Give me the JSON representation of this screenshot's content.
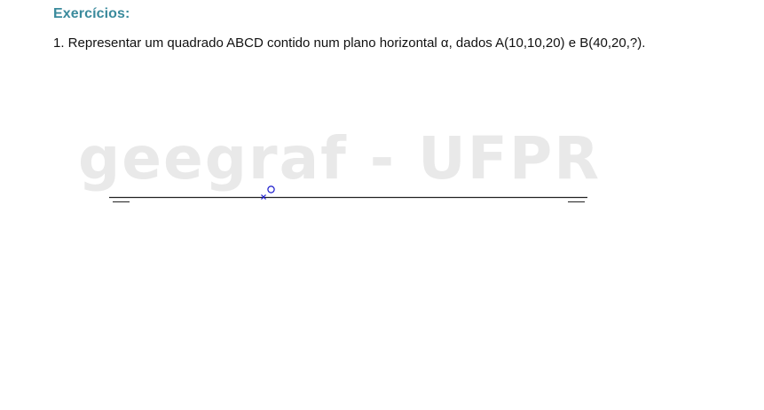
{
  "heading": "Exercícios:",
  "exercise": {
    "text": "1. Representar um quadrado ABCD contido num plano horizontal α, dados A(10,10,20) e B(40,20,?)."
  },
  "watermark": "geegraf - UFPR",
  "colors": {
    "heading": "#3a8a9c",
    "text": "#111111",
    "watermark": "#e9e9e9",
    "ground_line": "#222222",
    "point_marker": "#1a1acc"
  },
  "figure": {
    "ground_line": "x-axis line (linha de terra) with end tick marks",
    "origin_markers": [
      "x-mark",
      "circle-mark"
    ]
  }
}
